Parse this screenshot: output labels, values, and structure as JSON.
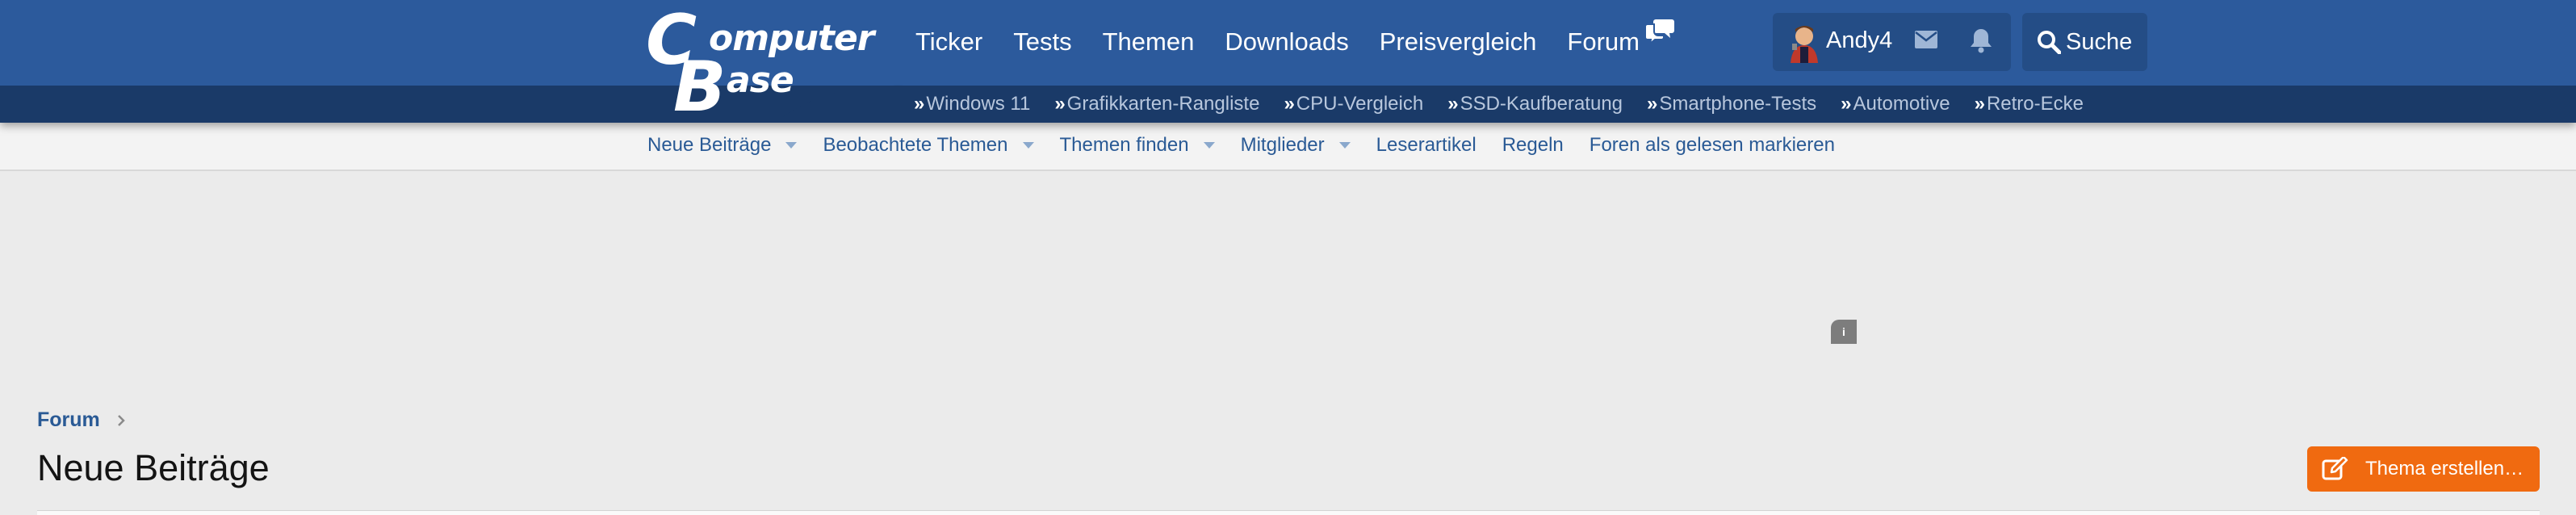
{
  "header": {
    "logo": {
      "line1_big": "C",
      "line1_small": "omputer",
      "line2_big": "B",
      "line2_small": "ase"
    },
    "nav": [
      "Ticker",
      "Tests",
      "Themen",
      "Downloads",
      "Preisvergleich",
      "Forum"
    ],
    "user": {
      "name": "Andy4"
    },
    "search_label": "Suche",
    "sub_links": [
      "Windows 11",
      "Grafikkarten-Rangliste",
      "CPU-Vergleich",
      "SSD-Kaufberatung",
      "Smartphone-Tests",
      "Automotive",
      "Retro-Ecke"
    ],
    "sub_link_prefix": "»"
  },
  "secondary_nav": [
    "Neue Beiträge",
    "Beobachtete Themen",
    "Themen finden",
    "Mitglieder",
    "Leserartikel",
    "Regeln",
    "Foren als gelesen markieren"
  ],
  "ad": {
    "info_label": "i"
  },
  "breadcrumb": {
    "forum": "Forum"
  },
  "page": {
    "title": "Neue Beiträge",
    "create_button": "Thema erstellen…"
  },
  "colors": {
    "header_bg": "#2c5a9c",
    "subbar_bg": "#1a3a68",
    "link": "#2a5a95",
    "accent_button": "#f06a10",
    "page_bg": "#ebebeb"
  },
  "icons": [
    "forum-chat-icon",
    "avatar",
    "mail-icon",
    "bell-icon",
    "search-icon",
    "chevron-right-icon",
    "caret-down-icon",
    "edit-icon"
  ]
}
